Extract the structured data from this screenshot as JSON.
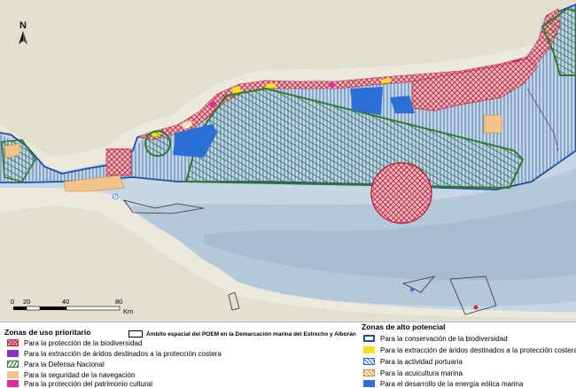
{
  "map": {
    "north_arrow_label": "N",
    "colors": {
      "sea": "#c6d6e4",
      "deep_sea": "#a9bfd3",
      "land": "#ece9dc",
      "coast_blue": "#1f4fa0",
      "defense_green": "#2f7a2a",
      "biodiv_red": "#c0253b",
      "wind_blue": "#2c6fd6",
      "navigation_orange": "#f2c38a"
    }
  },
  "scale_bar": {
    "ticks": [
      "0",
      "20",
      "40",
      "80"
    ],
    "unit": "Km"
  },
  "ambito_label": "Ámbito espacial del POEM en la Demarcación marina del Estrecho y Alborán",
  "legend_left": {
    "title": "Zonas de uso prioritario",
    "items": [
      {
        "label": "Para la protección de la biodiversidad",
        "swatch": "biodiversity-crosshatch"
      },
      {
        "label": "Para la extracción de áridos destinados a la protección costera",
        "swatch": "purple-fill"
      },
      {
        "label": "Para la  Defensa Nacional",
        "swatch": "green-hatch"
      },
      {
        "label": "Para la seguridad de la navegación",
        "swatch": "orange-fill"
      },
      {
        "label": "Para la protección del patrimonio cultural",
        "swatch": "magenta-fill"
      }
    ]
  },
  "legend_right": {
    "title": "Zonas de alto potencial",
    "items": [
      {
        "label": "Para la conservación de la biodiversidad",
        "swatch": "blue-outline"
      },
      {
        "label": "Para la extracción de áridos destinados a la protección costera",
        "swatch": "yellow-fill"
      },
      {
        "label": "Para la actividad portuaria",
        "swatch": "blue-hatch"
      },
      {
        "label": "Para la acuicultura marina",
        "swatch": "orange-hatch"
      },
      {
        "label": "Para el desarrollo de la energía eólica marina",
        "swatch": "blue-fill"
      }
    ]
  }
}
